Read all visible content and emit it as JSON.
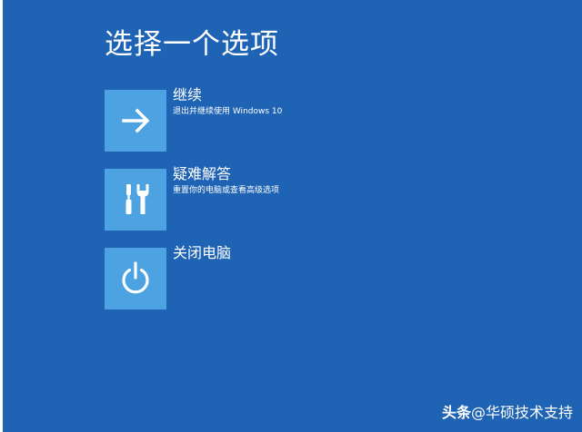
{
  "screen": {
    "title": "选择一个选项",
    "background": "#1f63b4",
    "tile_color": "#4da3e1"
  },
  "options": [
    {
      "icon": "arrow-right-icon",
      "label": "继续",
      "description": "退出并继续使用 Windows 10"
    },
    {
      "icon": "tools-icon",
      "label": "疑难解答",
      "description": "重置你的电脑或查看高级选项"
    },
    {
      "icon": "power-icon",
      "label": "关闭电脑",
      "description": ""
    }
  ],
  "watermark": {
    "brand": "头条",
    "handle": "@华硕技术支持"
  }
}
